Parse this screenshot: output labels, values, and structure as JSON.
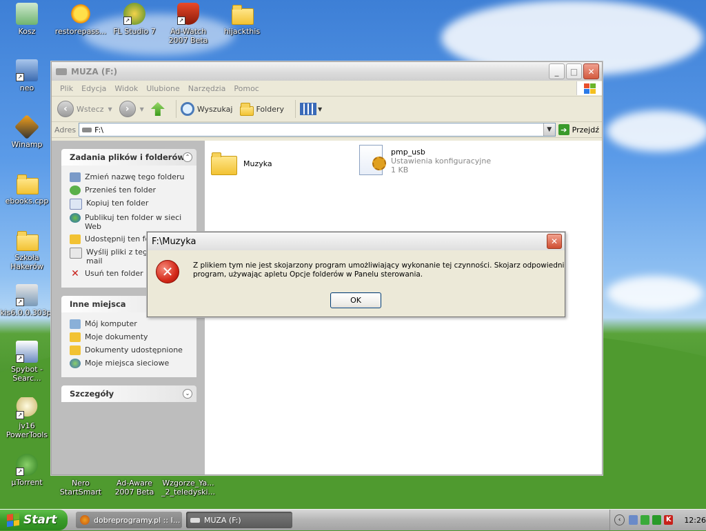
{
  "desktop": {
    "icons": [
      {
        "label": "Kosz"
      },
      {
        "label": "restorepass..."
      },
      {
        "label": "FL Studio 7"
      },
      {
        "label": "Ad-Watch 2007 Beta"
      },
      {
        "label": "hijackthis"
      },
      {
        "label": "neo"
      },
      {
        "label": "Winamp"
      },
      {
        "label": "ebooks.cpp"
      },
      {
        "label": "Szkoła Hakerów"
      },
      {
        "label": "kis6.0.0.303pl"
      },
      {
        "label": "Spybot - Searc..."
      },
      {
        "label": "jv16 PowerTools"
      },
      {
        "label": "µTorrent"
      },
      {
        "label": "Nero StartSmart"
      },
      {
        "label": "Ad-Aware 2007 Beta"
      },
      {
        "label": "Wzgorze_Ya... _2_teledyski..."
      }
    ]
  },
  "explorer": {
    "title": "MUZA (F:)",
    "menu": [
      "Plik",
      "Edycja",
      "Widok",
      "Ulubione",
      "Narzędzia",
      "Pomoc"
    ],
    "toolbar": {
      "back_label": "Wstecz",
      "search_label": "Wyszukaj",
      "folders_label": "Foldery"
    },
    "address": {
      "label": "Adres",
      "value": "F:\\",
      "go_label": "Przejdź"
    },
    "tasks_panel": {
      "title": "Zadania plików i folderów",
      "items": [
        "Zmień nazwę tego folderu",
        "Przenieś ten folder",
        "Kopiuj ten folder",
        "Publikuj ten folder w sieci Web",
        "Udostępnij ten fol",
        "Wyślij pliki z tego f pocztą e-mail",
        "Usuń ten folder"
      ]
    },
    "places_panel": {
      "title": "Inne miejsca",
      "items": [
        "Mój komputer",
        "Moje dokumenty",
        "Dokumenty udostępnione",
        "Moje miejsca sieciowe"
      ]
    },
    "details_panel": {
      "title": "Szczegóły"
    },
    "files": [
      {
        "name": "Muzyka"
      },
      {
        "name": "pmp_usb",
        "type": "Ustawienia konfiguracyjne",
        "size": "1 KB"
      }
    ]
  },
  "dialog": {
    "title": "F:\\Muzyka",
    "message": "Z plikiem tym nie jest skojarzony program umożliwiający wykonanie tej czynności. Skojarz odpowiedni program, używając apletu Opcje folderów w Panelu sterowania.",
    "ok_label": "OK"
  },
  "taskbar": {
    "start_label": "Start",
    "tasks": [
      {
        "label": "dobreprogramy.pl :: I..."
      },
      {
        "label": "MUZA (F:)"
      }
    ],
    "clock": "12:26"
  },
  "colors": {
    "error_red": "#d42a1a",
    "start_green": "#3a9b2a",
    "sky_blue": "#3d7fd6"
  }
}
